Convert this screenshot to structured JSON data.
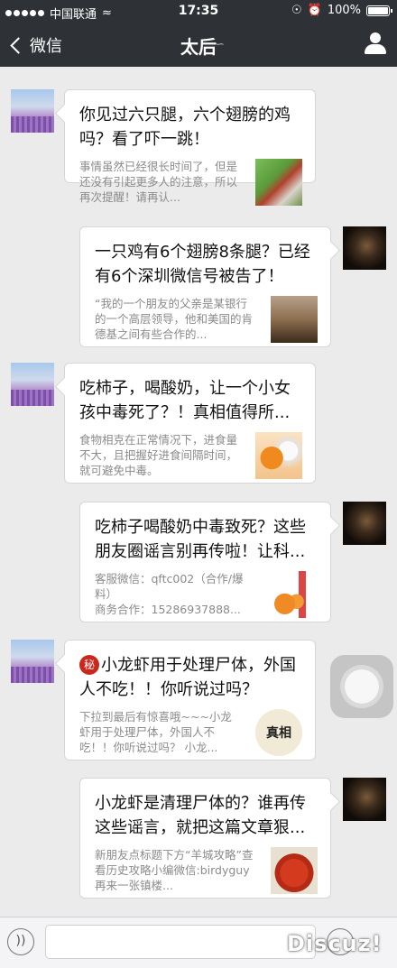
{
  "status_bar": {
    "carrier": "中国联通",
    "time": "17:35",
    "battery": "100%",
    "battery_level": 1.0
  },
  "nav": {
    "back_label": "微信",
    "title": "太后"
  },
  "messages": [
    {
      "side": "left",
      "title": "你见过六只腿，六个翅膀的鸡吗？看了吓一跳！",
      "desc": "事情虽然已经很长时间了，但是还没有引起更多人的注意，所以再次提醒！请再认...",
      "thumb": "rooster-image"
    },
    {
      "side": "right",
      "title": "一只鸡有6个翅膀8条腿？已经有6个深圳微信号被告了！",
      "desc": "“我的一个朋友的父亲是某银行的一个高层领导，他和美国的肯德基之间有些合作的...",
      "thumb": "gavel-image"
    },
    {
      "side": "left",
      "title": "吃柿子，喝酸奶，让一个小女孩中毒死了？！真相值得所...",
      "desc": "食物相克在正常情况下，进食量不大，且把握好进食间隔时间，就可避免中毒。",
      "thumb": "persimmon-yogurt-image"
    },
    {
      "side": "right",
      "title": "吃柿子喝酸奶中毒致死？这些朋友圈谣言别再传啦！让科...",
      "desc": "客服微信：qftc002（合作/爆料）\n商务合作：15286937888...",
      "thumb": "persimmon-yogurt-image-2"
    },
    {
      "side": "left",
      "badge": "秘",
      "title": "小龙虾用于处理尸体，外国人不吃！！你听说过吗？",
      "desc": "下拉到最后有惊喜哦~~~小龙虾用于处理尸体，外国人不吃！！你听说过吗？ 小龙...",
      "thumb": "truth-seal-image",
      "thumb_text": "真相"
    },
    {
      "side": "right",
      "title": "小龙虾是清理尸体的？谁再传这些谣言，就把这篇文章狠...",
      "desc": "新朋友点标题下方“羊城攻略”查看历史攻略小编微信:birdyguy再来一张镇楼...",
      "thumb": "crayfish-image"
    }
  ],
  "watermark": "Discuz!"
}
